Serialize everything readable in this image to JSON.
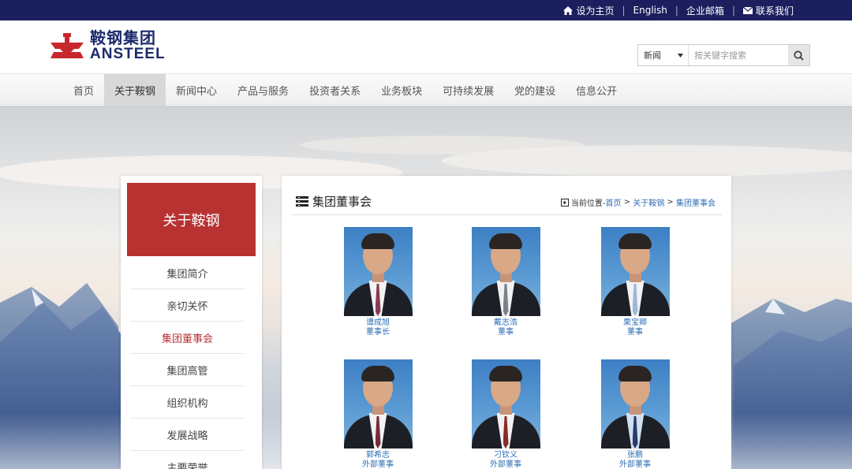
{
  "topbar": {
    "links": [
      {
        "label": "设为主页",
        "icon": "home-icon"
      },
      {
        "label": "English"
      },
      {
        "label": "企业邮箱"
      },
      {
        "label": "联系我们",
        "icon": "mail-icon"
      }
    ],
    "separator": "|"
  },
  "header": {
    "logo_cn": "鞍钢集团",
    "logo_en": "ANSTEEL",
    "search": {
      "select_value": "新闻",
      "placeholder": "按关键字搜索"
    }
  },
  "nav": {
    "items": [
      "首页",
      "关于鞍钢",
      "新闻中心",
      "产品与服务",
      "投资者关系",
      "业务板块",
      "可持续发展",
      "党的建设",
      "信息公开"
    ],
    "active_index": 1
  },
  "sidebar": {
    "title": "关于鞍钢",
    "items": [
      "集团简介",
      "亲切关怀",
      "集团董事会",
      "集团高管",
      "组织机构",
      "发展战略",
      "主要荣誉"
    ],
    "active_index": 2
  },
  "content": {
    "title": "集团董事会",
    "breadcrumb": {
      "prefix": "当前位置-",
      "trail": [
        "首页",
        "关于鞍钢",
        "集团董事会"
      ],
      "separator": " > "
    },
    "members": [
      {
        "name": "谭成旭",
        "role": "董事长",
        "tie": "#8a3b54",
        "shirt": "#f2f2f2"
      },
      {
        "name": "戴志浩",
        "role": "董事",
        "tie": "#7a7f8a",
        "shirt": "#f2f2f2"
      },
      {
        "name": "栗宝卿",
        "role": "董事",
        "tie": "#9db8d8",
        "shirt": "#f2f2f2"
      },
      {
        "name": "郭希志",
        "role": "外部董事",
        "tie": "#7a2a3a",
        "shirt": "#f2f2f2"
      },
      {
        "name": "刁钦义",
        "role": "外部董事",
        "tie": "#8a2a2a",
        "shirt": "#f2f2f2"
      },
      {
        "name": "张鹏",
        "role": "外部董事",
        "tie": "#2a3a6a",
        "shirt": "#cfe0f0"
      }
    ]
  }
}
